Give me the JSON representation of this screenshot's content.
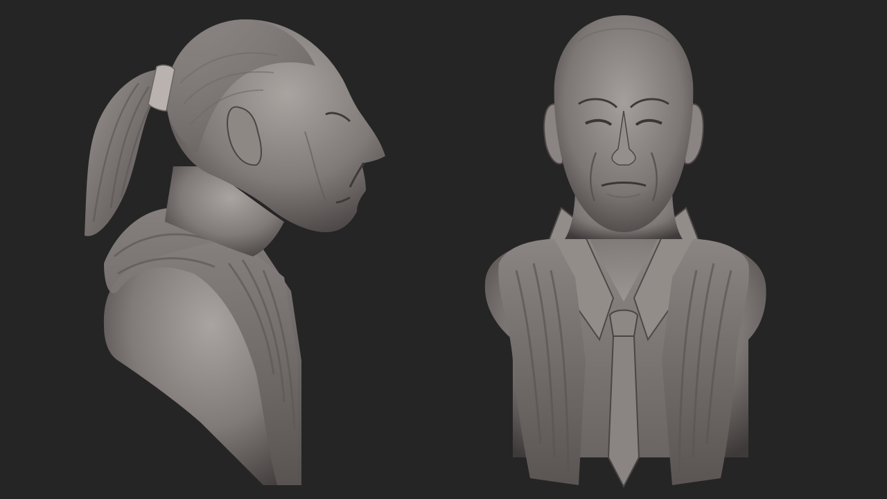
{
  "scene": {
    "subjects": [
      "sculpt-bust-profile",
      "sculpt-bust-front"
    ],
    "colors": {
      "background": "#252525",
      "clay_base": "#8a8482",
      "clay_light": "#b3adaa",
      "clay_shadow": "#4a4543",
      "clay_dark": "#2e2b2a"
    }
  }
}
